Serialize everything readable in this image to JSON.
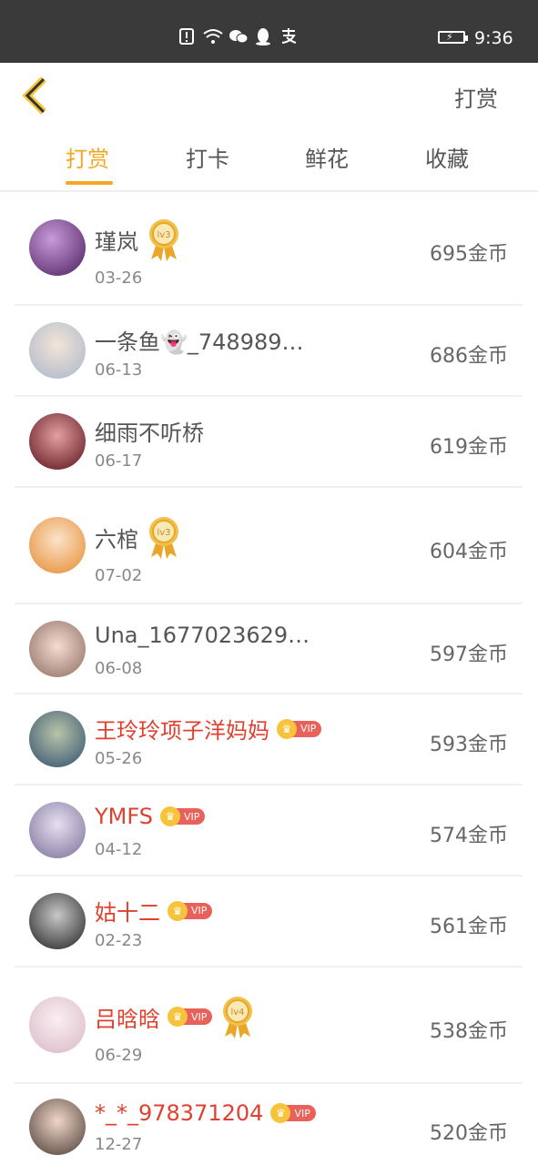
{
  "status_bar": {
    "time": "9:36",
    "icons": [
      "alert-icon",
      "wifi-icon",
      "wechat-icon",
      "qq-icon",
      "alipay-icon"
    ]
  },
  "header": {
    "action_label": "打赏"
  },
  "tabs": [
    {
      "label": "打赏",
      "active": true
    },
    {
      "label": "打卡",
      "active": false
    },
    {
      "label": "鲜花",
      "active": false
    },
    {
      "label": "收藏",
      "active": false
    }
  ],
  "colors": {
    "accent": "#f5a623",
    "vip_name": "#e0402f",
    "vip_badge": "#e8615a"
  },
  "rows": [
    {
      "name": "瑾岚",
      "date": "03-26",
      "coins": "695金币",
      "vip": false,
      "level": "lv3"
    },
    {
      "name": "一条鱼👻_748989…",
      "date": "06-13",
      "coins": "686金币",
      "vip": false,
      "level": ""
    },
    {
      "name": "细雨不听桥",
      "date": "06-17",
      "coins": "619金币",
      "vip": false,
      "level": ""
    },
    {
      "name": "六棺",
      "date": "07-02",
      "coins": "604金币",
      "vip": false,
      "level": "lv3"
    },
    {
      "name": "Una_1677023629…",
      "date": "06-08",
      "coins": "597金币",
      "vip": false,
      "level": ""
    },
    {
      "name": "王玲玲项子洋妈妈",
      "date": "05-26",
      "coins": "593金币",
      "vip": true,
      "level": ""
    },
    {
      "name": "YMFS",
      "date": "04-12",
      "coins": "574金币",
      "vip": true,
      "level": ""
    },
    {
      "name": "姑十二",
      "date": "02-23",
      "coins": "561金币",
      "vip": true,
      "level": ""
    },
    {
      "name": "吕晗晗",
      "date": "06-29",
      "coins": "538金币",
      "vip": true,
      "level": "lv4"
    },
    {
      "name": "*_*_978371204",
      "date": "12-27",
      "coins": "520金币",
      "vip": true,
      "level": ""
    }
  ],
  "vip_label": "VIP"
}
